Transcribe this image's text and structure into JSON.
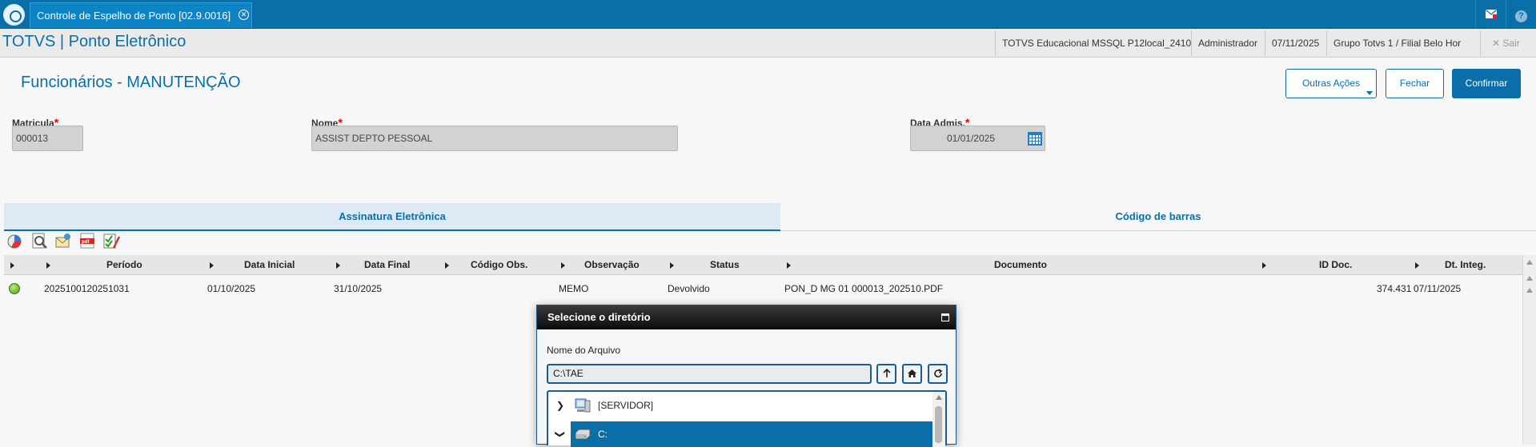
{
  "topbar": {
    "tab_title": "Controle de Espelho de Ponto [02.9.0016]",
    "tab_close": "✕",
    "mail_icon": "envelope-icon",
    "help_icon": "help-icon",
    "help_glyph": "?"
  },
  "appbar": {
    "title": "TOTVS | Ponto Eletrônico",
    "environment": "TOTVS Educacional MSSQL P12local_2410",
    "user": "Administrador",
    "date": "07/11/2025",
    "branch": "Grupo Totvs 1 / Filial Belo Hor",
    "exit_label": "✕  Sair"
  },
  "form": {
    "title": "Funcionários - MANUTENÇÃO",
    "buttons": {
      "other_actions": "Outras Ações",
      "close": "Fechar",
      "confirm": "Confirmar"
    },
    "fields": {
      "matricula": {
        "label": "Matricula",
        "value": "000013"
      },
      "nome": {
        "label": "Nome",
        "value": "ASSIST DEPTO PESSOAL"
      },
      "data_admis": {
        "label": "Data Admis.",
        "value": "01/01/2025"
      }
    },
    "required_mark": "*"
  },
  "tabs": {
    "signature": "Assinatura Eletrônica",
    "barcode": "Código de barras"
  },
  "toolbar_icons": [
    "legend-icon",
    "preview-icon",
    "email-icon",
    "pdf-icon",
    "approve-icon"
  ],
  "grid": {
    "columns": [
      "Período",
      "Data Inicial",
      "Data Final",
      "Código Obs.",
      "Observação",
      "Status",
      "Documento",
      "ID Doc.",
      "Dt. Integ."
    ],
    "rows": [
      {
        "status_color": "#5cb82a",
        "periodo": "2025100120251031",
        "data_inicial": "01/10/2025",
        "data_final": "31/10/2025",
        "codigo_obs": "",
        "observacao": "MEMO",
        "status": "Devolvido",
        "documento": "PON_D MG 01 000013_202510.PDF",
        "id_doc": "374.431",
        "dt_integ": "07/11/2025"
      }
    ]
  },
  "dialog": {
    "title": "Selecione o diretório",
    "file_label": "Nome do Arquivo",
    "path_value": "C:\\TAE",
    "buttons": [
      "arrow-up-icon",
      "home-icon",
      "refresh-icon"
    ],
    "tree": [
      {
        "label": "[SERVIDOR]",
        "icon": "server-icon",
        "expanded": false,
        "selected": false
      },
      {
        "label": "C:",
        "icon": "drive-icon",
        "expanded": true,
        "selected": true
      }
    ]
  },
  "colors": {
    "brand": "#0a6fa8",
    "required": "#ee0000"
  }
}
